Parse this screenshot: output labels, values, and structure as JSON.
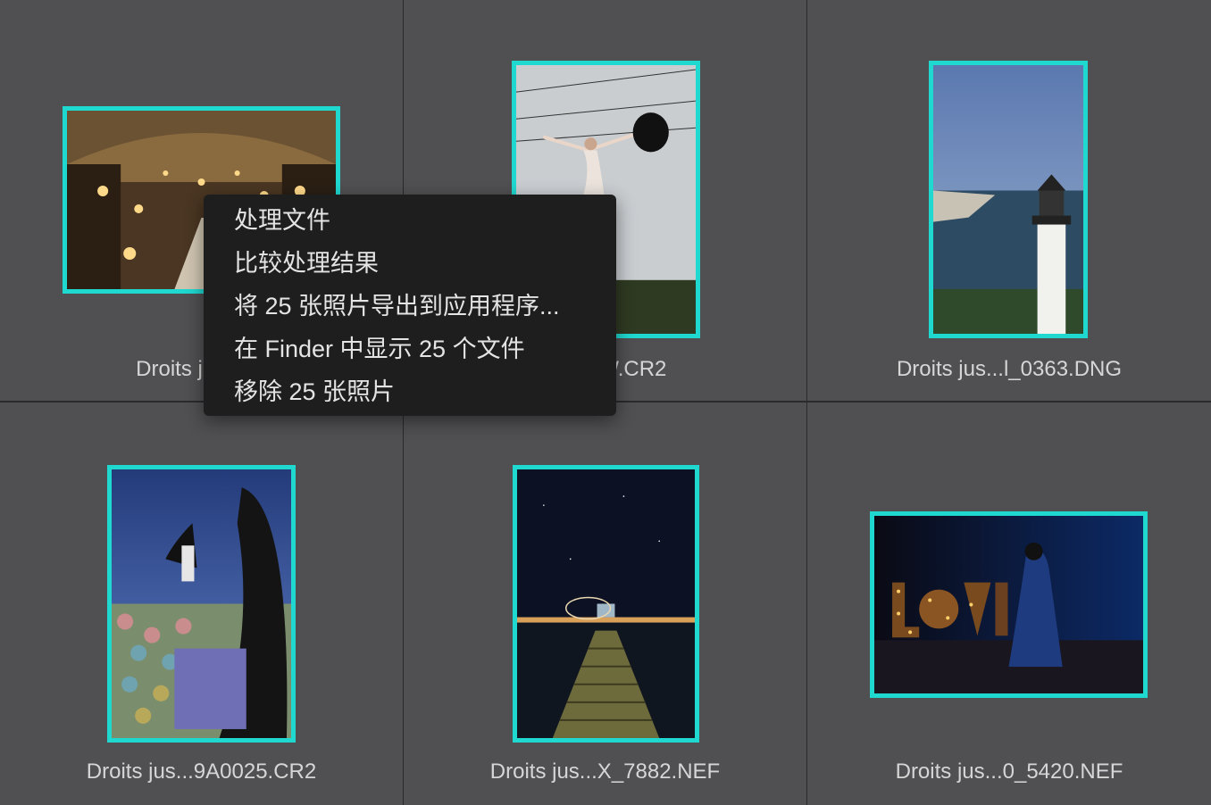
{
  "thumbnails": [
    {
      "filename": "Droits jusq...d",
      "icon": "opera-interior-photo"
    },
    {
      "filename": "S_RAW.CR2",
      "icon": "dancer-umbrella-photo"
    },
    {
      "filename": "Droits jus...l_0363.DNG",
      "icon": "lighthouse-photo"
    },
    {
      "filename": "Droits jus...9A0025.CR2",
      "icon": "girl-wind-photo"
    },
    {
      "filename": "Droits jus...X_7882.NEF",
      "icon": "pier-night-photo"
    },
    {
      "filename": "Droits jus...0_5420.NEF",
      "icon": "love-lights-photo"
    }
  ],
  "context_menu": {
    "items": [
      "处理文件",
      "比较处理结果",
      "将 25 张照片导出到应用程序...",
      "在 Finder 中显示 25 个文件",
      "移除 25 张照片"
    ]
  },
  "colors": {
    "selection_border": "#1fd8d0",
    "cell_bg": "#505052",
    "menu_bg": "#1e1e1f"
  }
}
